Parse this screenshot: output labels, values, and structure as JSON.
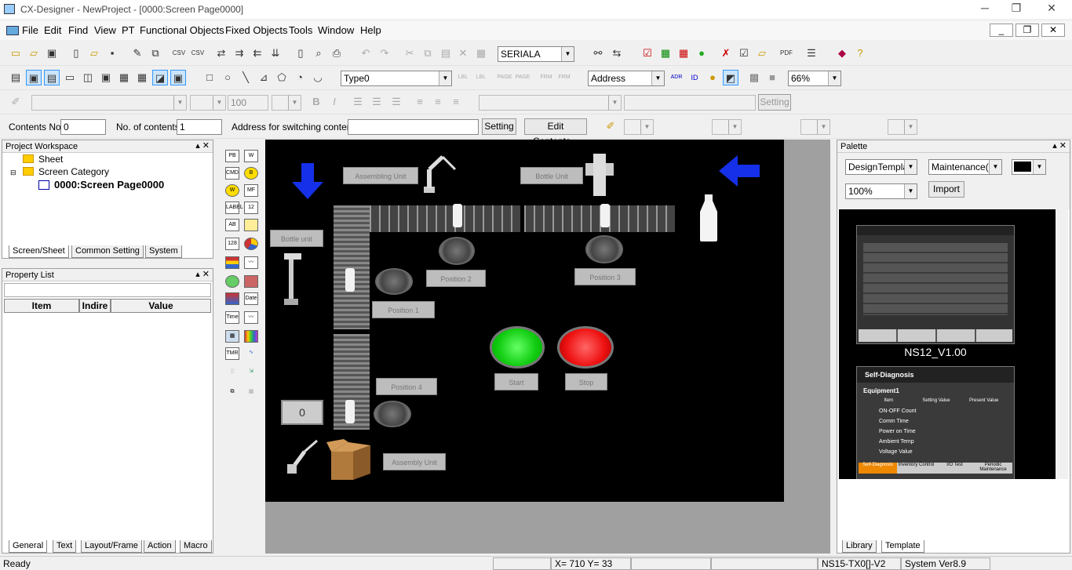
{
  "window": {
    "title": "CX-Designer - NewProject - [0000:Screen Page0000]",
    "minimize": "─",
    "restore": "❐",
    "close": "✕"
  },
  "menu": [
    "File",
    "Edit",
    "Find",
    "View",
    "PT",
    "Functional Objects",
    "Fixed Objects",
    "Tools",
    "Window",
    "Help"
  ],
  "mdi": {
    "minimize": "_",
    "restore": "❐",
    "close": "✕"
  },
  "toolbar1": {
    "serial": "SERIALA"
  },
  "toolbar2": {
    "type": "Type0",
    "address": "Address",
    "zoom": "66%"
  },
  "toolbar3": {
    "font_size": "100",
    "setting": "Setting"
  },
  "toolbar4": {
    "contents_no_label": "Contents No.",
    "contents_no": "0",
    "num_contents_label": "No. of contents",
    "num_contents": "1",
    "address_switch_label": "Address for switching contents",
    "setting": "Setting",
    "edit_contents": "Edit Contents..."
  },
  "workspace": {
    "title": "Project Workspace",
    "tree": [
      "Sheet",
      "Screen Category",
      "0000:Screen Page0000"
    ],
    "tabs": [
      "Screen/Sheet",
      "Common Setting",
      "System"
    ]
  },
  "property": {
    "title": "Property List",
    "cols": [
      "Item",
      "Indire",
      "Value"
    ],
    "tabs": [
      "General",
      "Text",
      "Layout/Frame",
      "Action",
      "Macro"
    ]
  },
  "objtools": [
    "PB",
    "W",
    "CMD",
    "B",
    "W",
    "MF",
    "LABEL",
    "12",
    "AB",
    "",
    "128",
    "",
    "",
    "",
    "",
    "",
    "",
    "Date",
    "Time",
    "",
    "",
    "",
    "TMR",
    "",
    "",
    "",
    "",
    ""
  ],
  "screen": {
    "labels": [
      "Assembling Unit",
      "Bottle Unit",
      "Bottle unit",
      "Position 2",
      "Position 3",
      "Position 1",
      "Position 4",
      "Start",
      "Stop",
      "Assembly Unit"
    ],
    "counter": "0"
  },
  "palette": {
    "title": "Palette",
    "category": "DesignTemplat",
    "type": "Maintenance(C",
    "zoom": "100%",
    "import": "Import",
    "template1": "NS12_V1.00",
    "t2title": "Self-Diagnosis",
    "t2section": "Equipment1",
    "t2cols": [
      "Item",
      "Setting Value",
      "Present Value"
    ],
    "t2rows": [
      "ON-OFF Count",
      "Comm Time",
      "Power on Time",
      "Ambient Temp",
      "Voltage Value"
    ],
    "t2tabs": [
      "Self-Diagnosis",
      "Inventory Control",
      "I/O Test",
      "Periodic Maintenance"
    ],
    "tabs": [
      "Library",
      "Template"
    ]
  },
  "status": {
    "ready": "Ready",
    "coords": "X= 710 Y=  33",
    "model": "NS15-TX0[]-V2",
    "version": "System Ver8.9"
  }
}
